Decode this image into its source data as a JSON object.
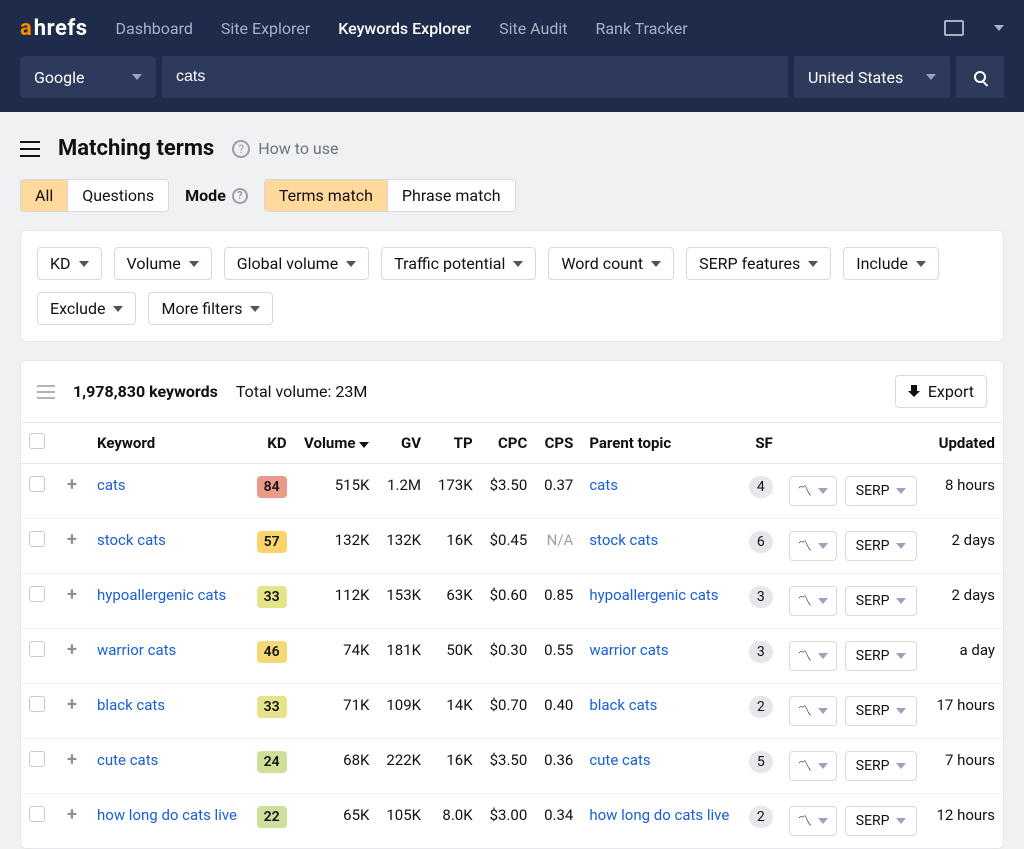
{
  "brand": {
    "a": "a",
    "rest": "hrefs"
  },
  "nav": {
    "items": [
      "Dashboard",
      "Site Explorer",
      "Keywords Explorer",
      "Site Audit",
      "Rank Tracker"
    ],
    "active_index": 2
  },
  "searchbar": {
    "engine": "Google",
    "query": "cats",
    "country": "United States"
  },
  "page": {
    "title": "Matching terms",
    "how_to_use": "How to use"
  },
  "tabs": {
    "type": {
      "items": [
        "All",
        "Questions"
      ],
      "selected": 0
    },
    "mode_label": "Mode",
    "mode": {
      "items": [
        "Terms match",
        "Phrase match"
      ],
      "selected": 0
    }
  },
  "filters": [
    "KD",
    "Volume",
    "Global volume",
    "Traffic potential",
    "Word count",
    "SERP features",
    "Include",
    "Exclude",
    "More filters"
  ],
  "results": {
    "count_label": "1,978,830 keywords",
    "total_volume_label": "Total volume: 23M",
    "export_label": "Export",
    "serp_label": "SERP",
    "columns": [
      "Keyword",
      "KD",
      "Volume",
      "GV",
      "TP",
      "CPC",
      "CPS",
      "Parent topic",
      "SF",
      "Updated"
    ],
    "sort_column": "Volume",
    "rows": [
      {
        "keyword": "cats",
        "kd": 84,
        "kd_color": "#e99a8b",
        "volume": "515K",
        "gv": "1.2M",
        "tp": "173K",
        "cpc": "$3.50",
        "cps": "0.37",
        "parent": "cats",
        "sf": 4,
        "updated": "8 hours"
      },
      {
        "keyword": "stock cats",
        "kd": 57,
        "kd_color": "#f9d46a",
        "volume": "132K",
        "gv": "132K",
        "tp": "16K",
        "cpc": "$0.45",
        "cps": "N/A",
        "parent": "stock cats",
        "sf": 6,
        "updated": "2 days"
      },
      {
        "keyword": "hypoallergenic cats",
        "kd": 33,
        "kd_color": "#e6e38a",
        "volume": "112K",
        "gv": "153K",
        "tp": "63K",
        "cpc": "$0.60",
        "cps": "0.85",
        "parent": "hypoallergenic cats",
        "sf": 3,
        "updated": "2 days"
      },
      {
        "keyword": "warrior cats",
        "kd": 46,
        "kd_color": "#f4da77",
        "volume": "74K",
        "gv": "181K",
        "tp": "50K",
        "cpc": "$0.30",
        "cps": "0.55",
        "parent": "warrior cats",
        "sf": 3,
        "updated": "a day"
      },
      {
        "keyword": "black cats",
        "kd": 33,
        "kd_color": "#e6e38a",
        "volume": "71K",
        "gv": "109K",
        "tp": "14K",
        "cpc": "$0.70",
        "cps": "0.40",
        "parent": "black cats",
        "sf": 2,
        "updated": "17 hours"
      },
      {
        "keyword": "cute cats",
        "kd": 24,
        "kd_color": "#cfe09a",
        "volume": "68K",
        "gv": "222K",
        "tp": "16K",
        "cpc": "$3.50",
        "cps": "0.36",
        "parent": "cute cats",
        "sf": 5,
        "updated": "7 hours"
      },
      {
        "keyword": "how long do cats live",
        "kd": 22,
        "kd_color": "#cfe09a",
        "volume": "65K",
        "gv": "105K",
        "tp": "8.0K",
        "cpc": "$3.00",
        "cps": "0.34",
        "parent": "how long do cats live",
        "sf": 2,
        "updated": "12 hours"
      }
    ]
  }
}
